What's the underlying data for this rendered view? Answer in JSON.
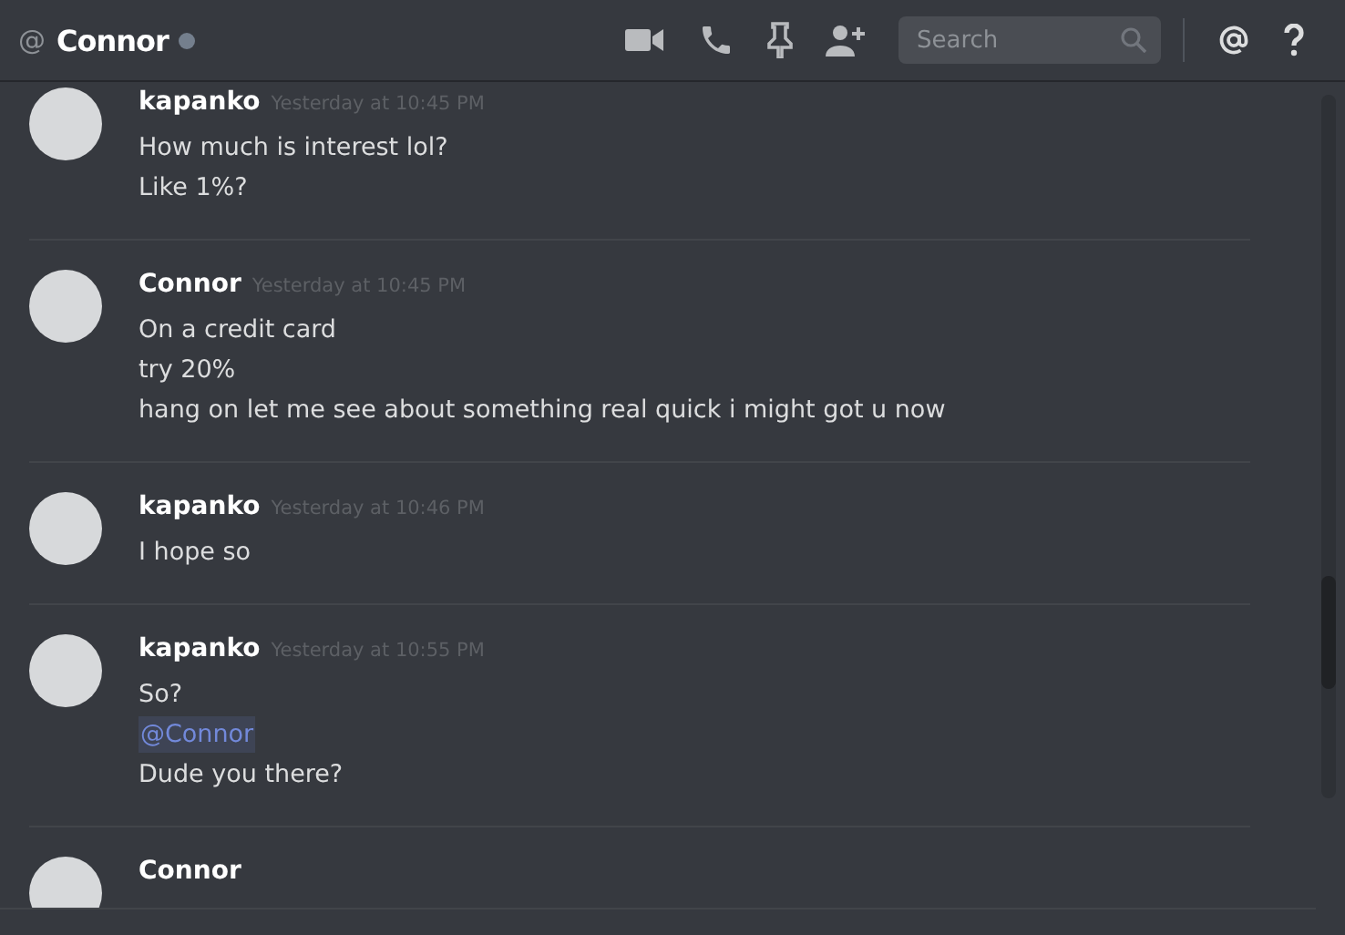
{
  "header": {
    "at_symbol": "@",
    "title": "Connor",
    "search": {
      "placeholder": "Search"
    }
  },
  "messages": [
    {
      "author": "kapanko",
      "timestamp": "Yesterday at 10:45 PM",
      "lines": [
        {
          "text": "How much is interest lol?"
        },
        {
          "text": "Like 1%?"
        }
      ]
    },
    {
      "author": "Connor",
      "timestamp": "Yesterday at 10:45 PM",
      "lines": [
        {
          "text": "On a credit card"
        },
        {
          "text": "try 20%"
        },
        {
          "text": "hang on let me see about something real quick i might got u now"
        }
      ]
    },
    {
      "author": "kapanko",
      "timestamp": "Yesterday at 10:46 PM",
      "lines": [
        {
          "text": "I hope so"
        }
      ]
    },
    {
      "author": "kapanko",
      "timestamp": "Yesterday at 10:55 PM",
      "lines": [
        {
          "text": "So?"
        },
        {
          "text": "@Connor",
          "kind": "mention"
        },
        {
          "text": "Dude you there?"
        }
      ]
    },
    {
      "author": "Connor"
    }
  ]
}
